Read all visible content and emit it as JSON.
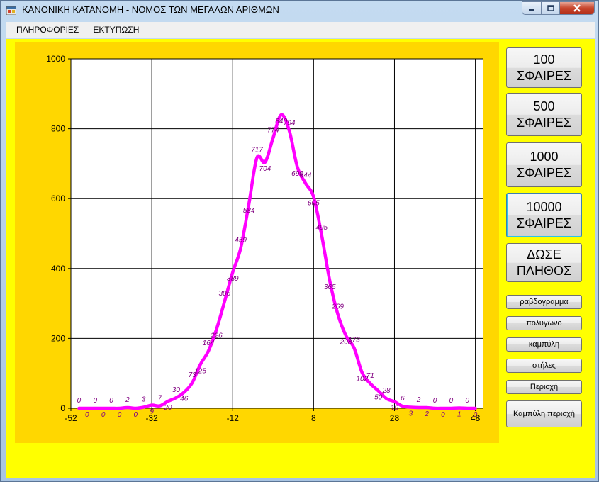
{
  "window": {
    "title": "ΚΑΝΟΝΙΚΗ ΚΑΤΑΝΟΜΗ - ΝΟΜΟΣ ΤΩΝ ΜΕΓΑΛΩΝ ΑΡΙΘΜΩΝ"
  },
  "menu": {
    "items": [
      "ΠΛΗΡΟΦΟΡΙΕΣ",
      "ΕΚΤΥΠΩΣΗ"
    ]
  },
  "buttons": {
    "b100": [
      "100",
      "ΣΦΑΙΡΕΣ"
    ],
    "b500": [
      "500",
      "ΣΦΑΙΡΕΣ"
    ],
    "b1000": [
      "1000",
      "ΣΦΑΙΡΕΣ"
    ],
    "b10000": [
      "10000",
      "ΣΦΑΙΡΕΣ"
    ],
    "bcustom": [
      "ΔΩΣΕ",
      "ΠΛΗΘΟΣ"
    ],
    "bar_chart": "ραβδογραμμα",
    "polygon": "πολυγωνο",
    "curve": "καμπύλη",
    "columns": "στήλες",
    "area": "Περιοχή",
    "curve_area": "Καμπύλη περιοχή"
  },
  "colors": {
    "curve": "#ff00ff",
    "label": "#800080",
    "plot_panel": "#ffd700",
    "client_bg": "#ffff00"
  },
  "chart_data": {
    "type": "line",
    "title": "",
    "xlabel": "",
    "ylabel": "",
    "xlim": [
      -52,
      50
    ],
    "ylim": [
      0,
      1000
    ],
    "x_ticks": [
      -52,
      -32,
      -12,
      8,
      28,
      48
    ],
    "y_ticks": [
      0,
      200,
      400,
      600,
      800,
      1000
    ],
    "grid": true,
    "x": [
      -50,
      -48,
      -46,
      -44,
      -42,
      -40,
      -38,
      -36,
      -34,
      -32,
      -30,
      -28,
      -26,
      -24,
      -22,
      -20,
      -18,
      -16,
      -14,
      -12,
      -10,
      -8,
      -6,
      -4,
      -2,
      0,
      2,
      4,
      6,
      8,
      10,
      12,
      14,
      16,
      18,
      20,
      22,
      24,
      26,
      28,
      30,
      32,
      34,
      36,
      38,
      40,
      42,
      44,
      46,
      48
    ],
    "values": [
      0,
      0,
      0,
      0,
      0,
      0,
      2,
      0,
      3,
      9,
      7,
      20,
      30,
      46,
      73,
      125,
      164,
      226,
      306,
      389,
      459,
      584,
      717,
      704,
      774,
      840,
      794,
      690,
      644,
      605,
      495,
      365,
      269,
      208,
      173,
      102,
      71,
      50,
      28,
      19,
      6,
      3,
      2,
      2,
      0,
      0,
      0,
      1,
      0,
      0
    ]
  }
}
